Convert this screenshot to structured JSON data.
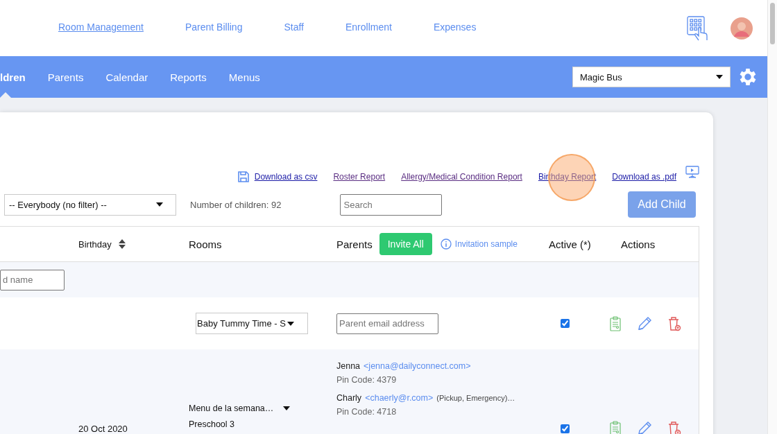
{
  "top_nav": {
    "links": [
      {
        "label": "Room Management",
        "selected": true
      },
      {
        "label": "Parent Billing",
        "selected": false
      },
      {
        "label": "Staff",
        "selected": false
      },
      {
        "label": "Enrollment",
        "selected": false
      },
      {
        "label": "Expenses",
        "selected": false
      }
    ]
  },
  "main_nav": {
    "tabs": [
      {
        "label": "ldren",
        "selected": true
      },
      {
        "label": "Parents",
        "selected": false
      },
      {
        "label": "Calendar",
        "selected": false
      },
      {
        "label": "Reports",
        "selected": false
      },
      {
        "label": "Menus",
        "selected": false
      }
    ],
    "center_select": {
      "value": "Magic Bus"
    }
  },
  "toolbar": {
    "links": [
      {
        "label": "Download as csv",
        "kind": "download",
        "visited": false
      },
      {
        "label": "Roster Report",
        "kind": "link",
        "visited": true
      },
      {
        "label": "Allergy/Medical Condition Report",
        "kind": "link",
        "visited": true
      },
      {
        "label": "Birthday Report",
        "kind": "link",
        "visited": false
      },
      {
        "label": "Download as .pdf",
        "kind": "link",
        "visited": false
      }
    ]
  },
  "filter": {
    "value": "-- Everybody (no filter) --"
  },
  "count": "Number of children: 92",
  "search": {
    "placeholder": "Search"
  },
  "add_button": "Add Child",
  "table": {
    "columns": [
      {
        "label": "Birthday",
        "kind": "sortable"
      },
      {
        "label": "Rooms",
        "kind": "plain"
      },
      {
        "label": "Parents",
        "kind": "parents"
      },
      {
        "label": "Active (*)",
        "kind": "plain"
      },
      {
        "label": "Actions",
        "kind": "plain"
      }
    ],
    "invite_button": "Invite All",
    "invitation_link": "Invitation sample",
    "name_filter": {
      "placeholder": "d name"
    },
    "rows": [
      {
        "birthday": "",
        "rooms": {
          "kind": "select",
          "value": "Baby Tummy Time - S"
        },
        "parents": {
          "kind": "input",
          "placeholder": "Parent email address"
        },
        "active": true
      },
      {
        "birthday": "20 Oct 2020",
        "rooms": {
          "kind": "menu",
          "menu": "Menu de la semana…",
          "room": "Preschool 3"
        },
        "parents": {
          "kind": "list",
          "people": [
            {
              "name": "Jenna",
              "email": "<jenna@dailyconnect.com>",
              "pin": "Pin Code: 4379"
            },
            {
              "name": "Charly",
              "email": "<chaerly@r.com>",
              "roles": "(Pickup, Emergency)…",
              "pin": "Pin Code: 4718"
            }
          ]
        },
        "active": true
      }
    ]
  }
}
